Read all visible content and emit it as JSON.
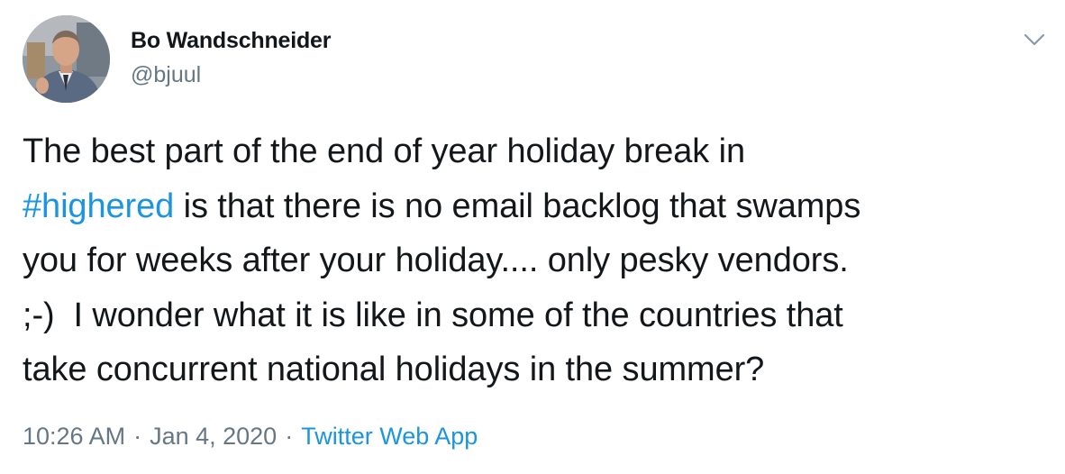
{
  "author": {
    "name": "Bo Wandschneider",
    "handle": "@bjuul",
    "avatar_icon": "profile-photo"
  },
  "caret_icon": "chevron-down-icon",
  "tweet": {
    "lines": [
      {
        "before": "The best part of the end of year holiday break in",
        "hashtag": "",
        "after": ""
      },
      {
        "before": "",
        "hashtag": "#highered",
        "after": " is that there is no email backlog that swamps"
      },
      {
        "before": "you for weeks after your holiday.... only pesky vendors.",
        "hashtag": "",
        "after": ""
      },
      {
        "before": ";-)  I wonder what it is like in some of the countries that",
        "hashtag": "",
        "after": ""
      },
      {
        "before": "take concurrent national holidays in the summer?",
        "hashtag": "",
        "after": ""
      }
    ]
  },
  "meta": {
    "time": "10:26 AM",
    "separator": "·",
    "date": "Jan 4, 2020",
    "source": "Twitter Web App"
  },
  "colors": {
    "link": "#1b95e0",
    "secondary_text": "#657786",
    "primary_text": "#14171a"
  }
}
